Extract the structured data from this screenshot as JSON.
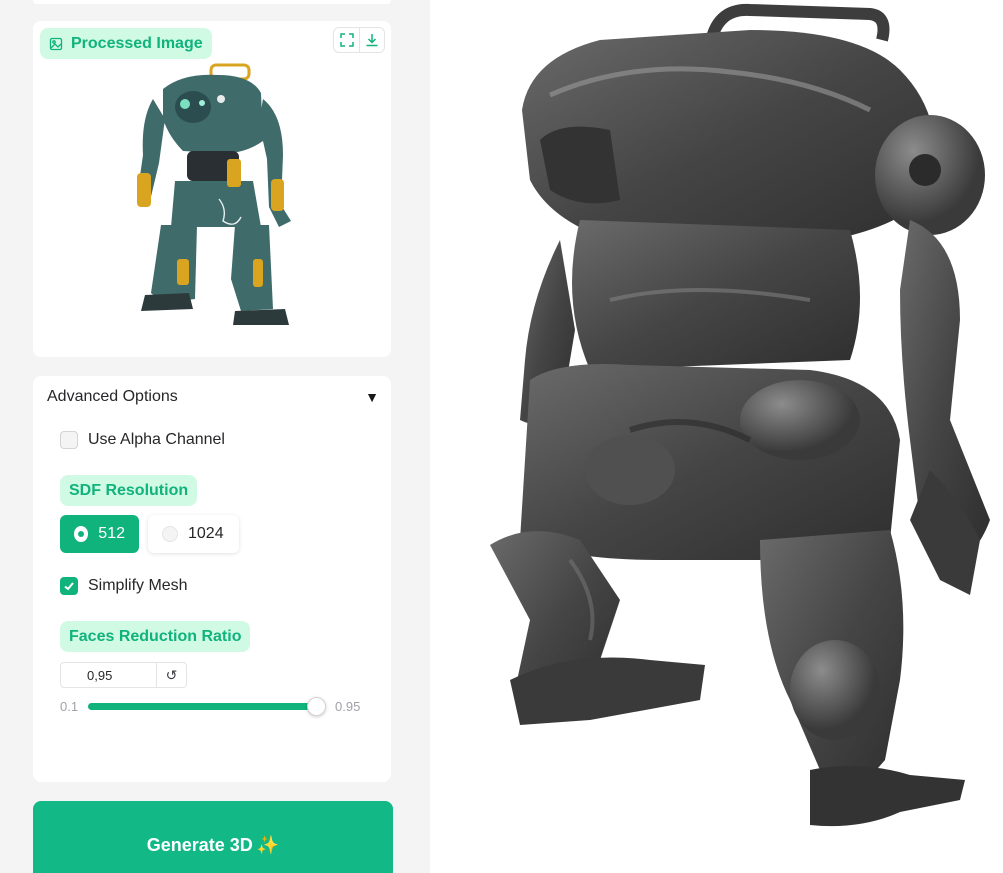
{
  "processed_image": {
    "label": "Processed Image",
    "fullscreen_icon": "fullscreen-icon",
    "download_icon": "download-icon",
    "colors": {
      "armor": "#3f6b6b",
      "accent": "#d9a521",
      "visor": "#7be0c0"
    }
  },
  "advanced": {
    "title": "Advanced Options",
    "collapse_glyph": "▼",
    "use_alpha_label": "Use Alpha Channel",
    "use_alpha_checked": false,
    "sdf_label": "SDF Resolution",
    "sdf_options": [
      "512",
      "1024"
    ],
    "sdf_selected": "512",
    "simplify_label": "Simplify Mesh",
    "simplify_checked": true,
    "faces_label": "Faces Reduction Ratio",
    "faces_value": "0,95",
    "reset_glyph": "↺",
    "slider_min": "0.1",
    "slider_max": "0.95",
    "slider_fraction": 1.0
  },
  "generate": {
    "label": "Generate 3D",
    "emoji": "✨"
  },
  "viewer": {
    "model": "3d-mesh-robot",
    "mesh_color": "#4a4a4a"
  },
  "colors": {
    "accent": "#10b37c",
    "accent_light": "#d1fae5"
  }
}
